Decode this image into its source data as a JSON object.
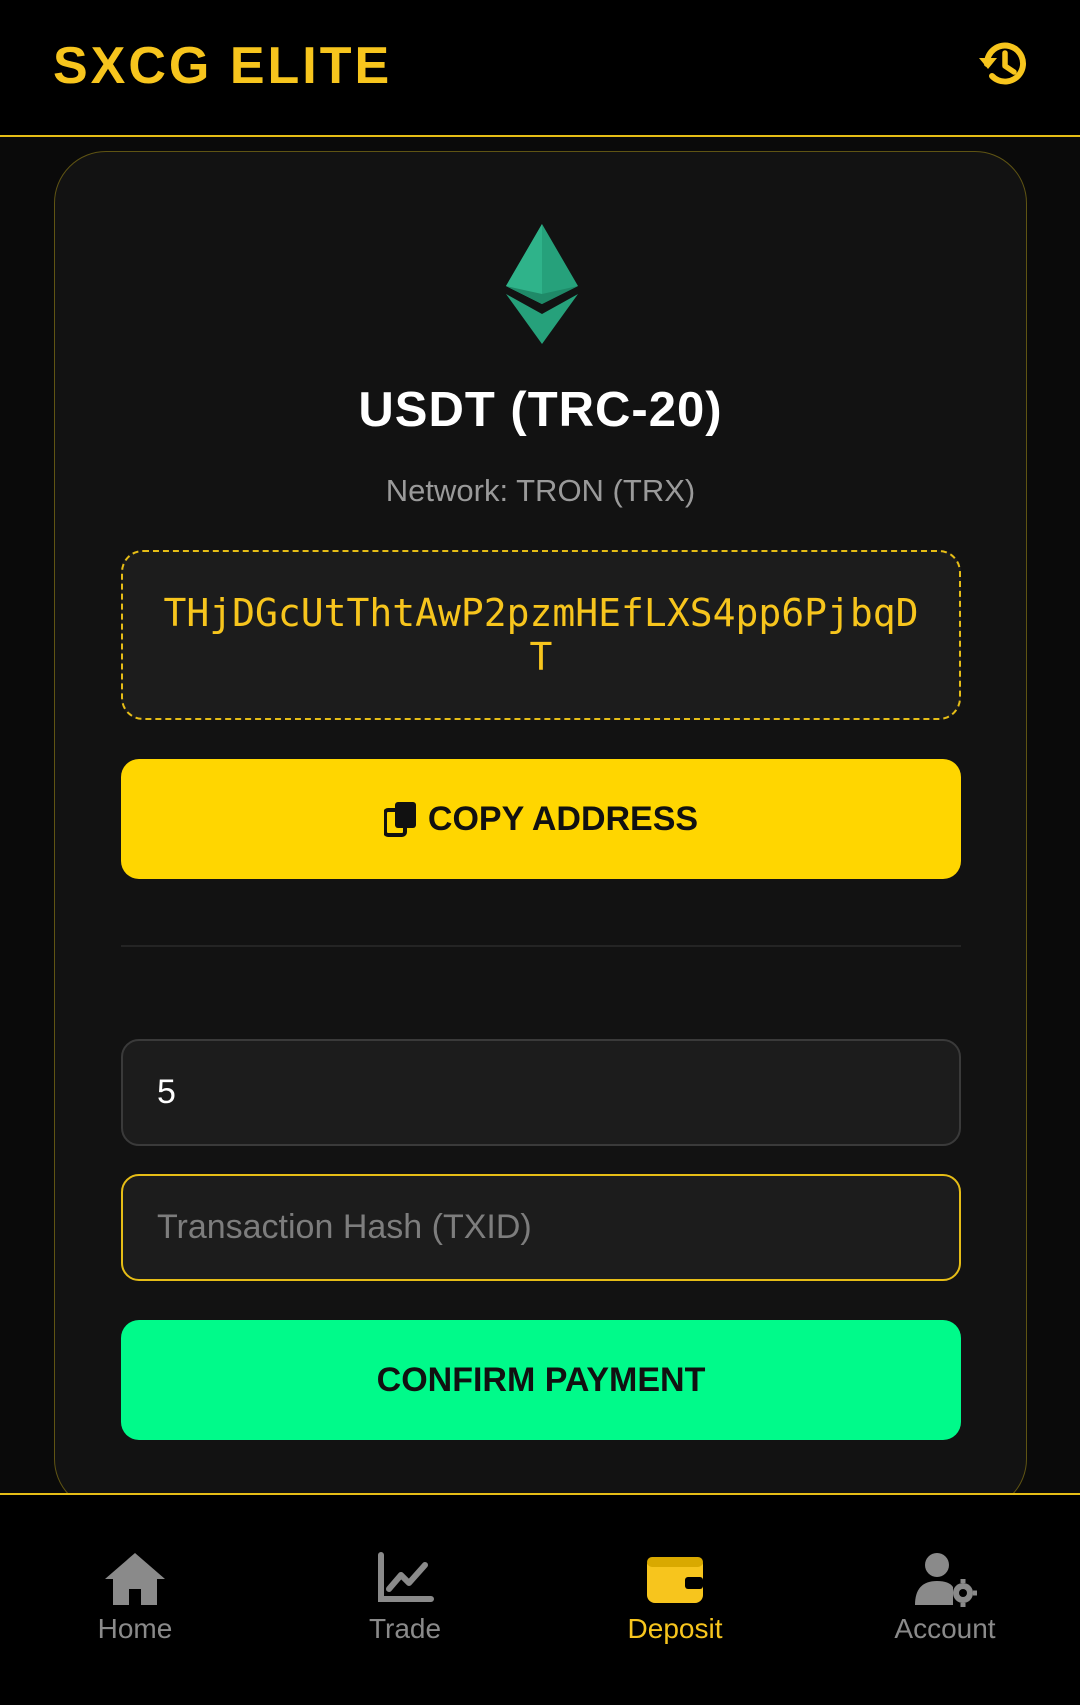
{
  "header": {
    "brand": "SXCG ELITE",
    "history_icon": "history-icon"
  },
  "deposit": {
    "coin_icon": "ethereum-icon",
    "coin_title": "USDT (TRC-20)",
    "network": "Network: TRON (TRX)",
    "address": "THjDGcUtThtAwP2pzmHEfLXS4pp6PjbqDT",
    "copy_icon": "copy-icon",
    "copy_label": "COPY ADDRESS",
    "amount_value": "5",
    "txid_placeholder": "Transaction Hash (TXID)",
    "confirm_label": "CONFIRM PAYMENT"
  },
  "nav": {
    "items": [
      {
        "label": "Home",
        "icon": "home-icon",
        "active": false
      },
      {
        "label": "Trade",
        "icon": "chart-line-icon",
        "active": false
      },
      {
        "label": "Deposit",
        "icon": "wallet-icon",
        "active": true
      },
      {
        "label": "Account",
        "icon": "user-gear-icon",
        "active": false
      }
    ]
  },
  "colors": {
    "accent": "#f7c51d",
    "copy_button": "#ffd600",
    "confirm_button": "#00fa8a",
    "coin_icon": "#26a17b"
  }
}
